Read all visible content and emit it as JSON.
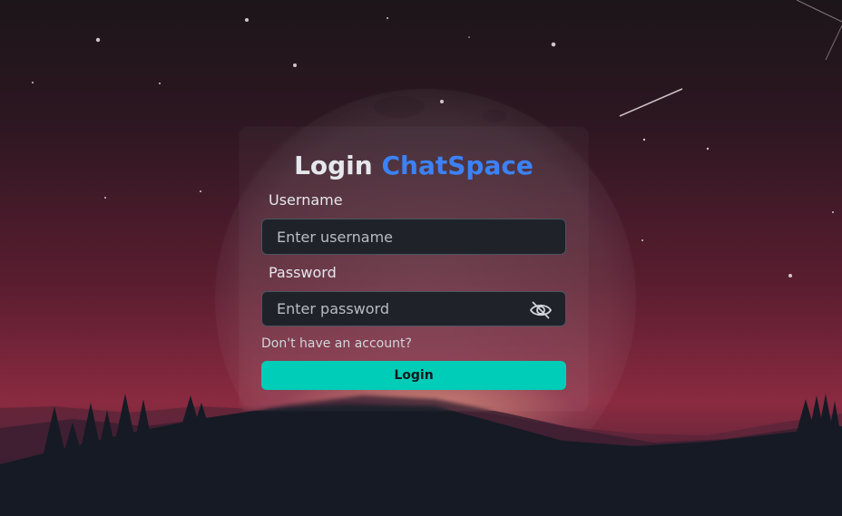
{
  "login_form": {
    "title_prefix": "Login",
    "title_brand": "ChatSpace",
    "username_label": "Username",
    "username_placeholder": "Enter username",
    "username_value": "",
    "password_label": "Password",
    "password_placeholder": "Enter password",
    "password_value": "",
    "password_toggle_icon": "eye-slash-icon",
    "signup_link": "Don't have an account?",
    "login_button": "Login"
  },
  "colors": {
    "brand_accent": "#3b82f6",
    "login_button": "#00cdb8",
    "input_background": "#1f2329"
  }
}
